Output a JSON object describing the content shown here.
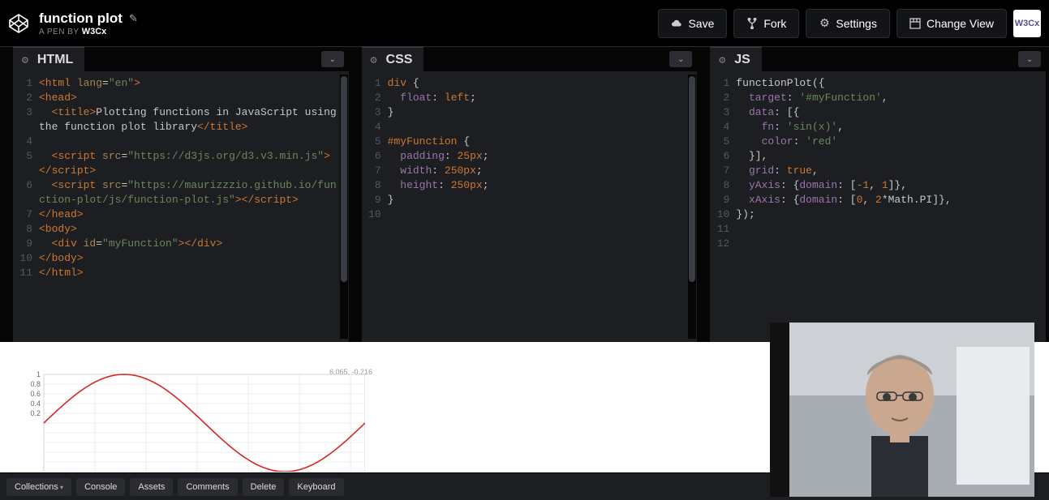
{
  "header": {
    "title": "function plot",
    "subtitle_prefix": "A PEN BY",
    "author": "W3Cx",
    "save": "Save",
    "fork": "Fork",
    "settings": "Settings",
    "change_view": "Change View",
    "avatar": "W3Cx"
  },
  "panes": {
    "html": {
      "title": "HTML"
    },
    "css": {
      "title": "CSS"
    },
    "js": {
      "title": "JS"
    }
  },
  "code": {
    "html": {
      "l1_a": "<html",
      "l1_b": " lang",
      "l1_c": "=",
      "l1_d": "\"en\"",
      "l1_e": ">",
      "l2": "<head>",
      "l3_a": "  <title>",
      "l3_b": "Plotting functions in JavaScript using the function plot library",
      "l3_c": "</title>",
      "l5_a": "  <script",
      "l5_b": " src",
      "l5_c": "=",
      "l5_d": "\"https://d3js.org/d3.v3.min.js\"",
      "l5_e": "></",
      "l5_f": "script>",
      "l6_a": "  <script",
      "l6_b": " src",
      "l6_c": "=",
      "l6_d": "\"https://maurizzzio.github.io/function-plot/js/function-plot.js\"",
      "l6_e": "></",
      "l6_f": "script>",
      "l7": "</head>",
      "l8": "<body>",
      "l9_a": "  <div",
      "l9_b": " id",
      "l9_c": "=",
      "l9_d": "\"myFunction\"",
      "l9_e": "></div>",
      "l10": "</body>",
      "l11": "</html>"
    },
    "css": {
      "l1_a": "div",
      "l1_b": " {",
      "l2_a": "  float",
      "l2_b": ": ",
      "l2_c": "left",
      "l2_d": ";",
      "l3": "}",
      "l5_a": "#myFunction",
      "l5_b": " {",
      "l6_a": "  padding",
      "l6_b": ": ",
      "l6_c": "25px",
      "l6_d": ";",
      "l7_a": "  width",
      "l7_b": ": ",
      "l7_c": "250px",
      "l7_d": ";",
      "l8_a": "  height",
      "l8_b": ": ",
      "l8_c": "250px",
      "l8_d": ";",
      "l9": "}"
    },
    "js": {
      "l1": "functionPlot({",
      "l2_a": "  target",
      "l2_b": ": ",
      "l2_c": "'#myFunction'",
      "l2_d": ",",
      "l3_a": "  data",
      "l3_b": ": [{",
      "l4_a": "    fn",
      "l4_b": ": ",
      "l4_c": "'sin(x)'",
      "l4_d": ",",
      "l5_a": "    color",
      "l5_b": ": ",
      "l5_c": "'red'",
      "l6": "  }],",
      "l7_a": "  grid",
      "l7_b": ": ",
      "l7_c": "true",
      "l7_d": ",",
      "l8_a": "  yAxis",
      "l8_b": ": {",
      "l8_c": "domain",
      "l8_d": ": [",
      "l8_e": "-1",
      "l8_f": ", ",
      "l8_g": "1",
      "l8_h": "]},",
      "l9_a": "  xAxis",
      "l9_b": ": {",
      "l9_c": "domain",
      "l9_d": ": [",
      "l9_e": "0",
      "l9_f": ", ",
      "l9_g": "2",
      "l9_h": "*Math.PI]},",
      "l10": "});"
    }
  },
  "output": {
    "tooltip": "6.065, -0.216"
  },
  "chart_data": {
    "type": "line",
    "series": [
      {
        "name": "sin(x)",
        "color": "#d62728",
        "fn": "sin(x)"
      }
    ],
    "x": [
      0,
      0.5,
      1.0,
      1.5,
      2.0,
      2.5,
      3.0,
      3.14,
      3.5,
      4.0,
      4.5,
      5.0,
      5.5,
      6.0,
      6.28
    ],
    "y": [
      0,
      0.48,
      0.84,
      1.0,
      0.91,
      0.6,
      0.14,
      0.0,
      -0.35,
      -0.76,
      -0.98,
      -0.96,
      -0.71,
      -0.28,
      0.0
    ],
    "xlabel": "",
    "ylabel": "",
    "xlim": [
      0,
      6.283
    ],
    "ylim": [
      -1,
      1
    ],
    "yticks": [
      "1",
      "0.8",
      "0.6",
      "0.4",
      "0.2"
    ],
    "grid": true
  },
  "footer": {
    "collections": "Collections",
    "console": "Console",
    "assets": "Assets",
    "comments": "Comments",
    "delete": "Delete",
    "keyboard": "Keyboard"
  }
}
